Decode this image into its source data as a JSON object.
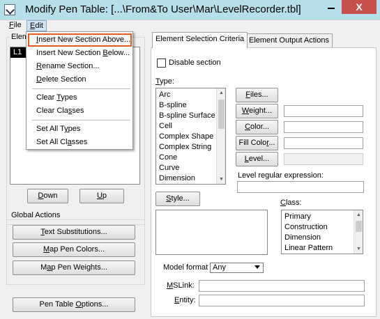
{
  "window": {
    "title": "Modify Pen Table: [...\\From&To User\\Mar\\LevelRecorder.tbl]",
    "close_label": "X"
  },
  "menubar": {
    "file": {
      "first": "F",
      "rest": "ile"
    },
    "edit": {
      "first": "E",
      "rest": "dit"
    }
  },
  "edit_menu": {
    "items": [
      {
        "pre": "",
        "key": "I",
        "post": "nsert New Section Above..."
      },
      {
        "pre": "Insert New Section ",
        "key": "B",
        "post": "elow..."
      },
      {
        "pre": "",
        "key": "R",
        "post": "ename Section..."
      },
      {
        "pre": "",
        "key": "D",
        "post": "elete Section"
      },
      {
        "pre": "Clear ",
        "key": "T",
        "post": "ypes"
      },
      {
        "pre": "Clear Cla",
        "key": "s",
        "post": "ses"
      },
      {
        "pre": "Set All T",
        "key": "y",
        "post": "pes"
      },
      {
        "pre": "Set All Cl",
        "key": "a",
        "post": "sses"
      }
    ]
  },
  "sections": {
    "label_visible": "Elem",
    "items": [
      "L1"
    ],
    "down": {
      "pre": "",
      "key": "D",
      "post": "own"
    },
    "up": {
      "pre": "",
      "key": "U",
      "post": "p"
    }
  },
  "global_actions": {
    "label": "Global Actions",
    "text_substitutions": {
      "pre": "",
      "key": "T",
      "post": "ext Substitutions..."
    },
    "map_pen_colors": {
      "pre": "",
      "key": "M",
      "post": "ap Pen Colors..."
    },
    "map_pen_weights": {
      "pre": "M",
      "key": "a",
      "post": "p Pen Weights..."
    }
  },
  "pen_table_options": {
    "pre": "Pen Table ",
    "key": "O",
    "post": "ptions..."
  },
  "tabs": {
    "selection": "Element Selection Criteria",
    "output": "Element Output Actions"
  },
  "criteria": {
    "disable_section": "Disable section",
    "disable_checked": false,
    "type_label": {
      "pre": "",
      "key": "T",
      "post": "ype:"
    },
    "types": [
      "Arc",
      "B-spline",
      "B-spline Surface",
      "Cell",
      "Complex Shape",
      "Complex String",
      "Cone",
      "Curve",
      "Dimension"
    ],
    "files": {
      "pre": "",
      "key": "F",
      "post": "iles..."
    },
    "weight": {
      "pre": "",
      "key": "W",
      "post": "eight..."
    },
    "color": {
      "pre": "",
      "key": "C",
      "post": "olor..."
    },
    "fill_color": {
      "pre": "Fill Colo",
      "key": "r",
      "post": "..."
    },
    "level": {
      "pre": "",
      "key": "L",
      "post": "evel..."
    },
    "level_regex_label": "Level regular expression:",
    "style": {
      "pre": "",
      "key": "S",
      "post": "tyle..."
    },
    "class_label": {
      "pre": "",
      "key": "C",
      "post": "lass:"
    },
    "classes": [
      "Primary",
      "Construction",
      "Dimension",
      "Linear Pattern"
    ],
    "model_format_label": "Model format",
    "model_format_value": "Any",
    "mslink_label": {
      "pre": "",
      "key": "M",
      "post": "SLink:"
    },
    "entity_label": {
      "pre": "",
      "key": "E",
      "post": "ntity:"
    }
  },
  "colors": {
    "titlebar": "#b7dfe9",
    "close": "#c7504d",
    "highlight": "#e85a1c",
    "selection": "#000000"
  }
}
